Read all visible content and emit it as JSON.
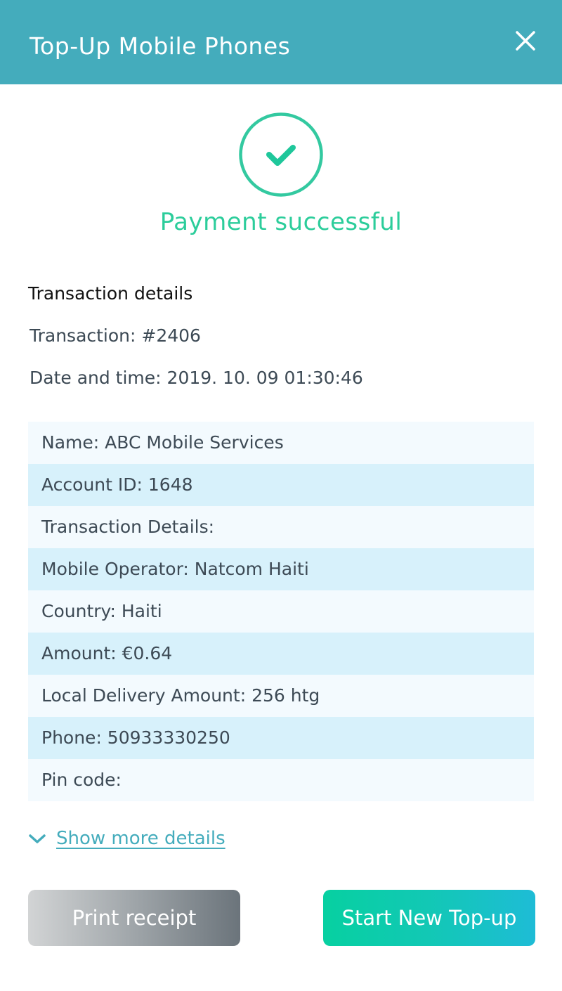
{
  "header": {
    "title": "Top-Up Mobile Phones",
    "close_icon": "close-icon",
    "background": "#44acbc"
  },
  "status": {
    "icon": "check-circle-icon",
    "message": "Payment successful",
    "color": "#2ccd9b"
  },
  "transaction": {
    "section_title": "Transaction details",
    "number_line": "Transaction: #2406",
    "datetime_line": "Date and time: 2019. 10. 09 01:30:46"
  },
  "details": {
    "rows": [
      "Name: ABC Mobile Services",
      "Account ID: 1648",
      "Transaction Details:",
      "Mobile Operator: Natcom Haiti",
      "Country: Haiti",
      "Amount: €0.64",
      "Local Delivery Amount: 256 htg",
      "Phone: 50933330250",
      "Pin code:"
    ],
    "row_colors": [
      "#f3fafe",
      "#d7f1fb"
    ]
  },
  "show_more": {
    "icon": "chevron-down-icon",
    "label": "Show more details"
  },
  "actions": {
    "print_label": "Print receipt",
    "new_topup_label": "Start New Top-up"
  }
}
